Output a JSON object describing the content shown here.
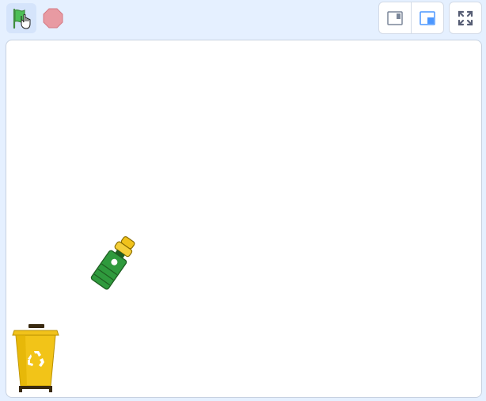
{
  "toolbar": {
    "green_flag_icon": "green-flag-icon",
    "stop_icon": "stop-sign-icon",
    "stage_mode_small_icon": "small-stage-icon",
    "stage_mode_normal_icon": "normal-stage-icon",
    "fullscreen_icon": "fullscreen-icon"
  },
  "stage": {
    "sprites": [
      {
        "name": "bottle",
        "icon": "bottle-sprite"
      },
      {
        "name": "recycle-bin",
        "icon": "recycle-bin-sprite"
      }
    ]
  },
  "colors": {
    "background": "#e5f0ff",
    "flag_green": "#59c059",
    "stop_red": "#ec5959",
    "accent_blue": "#4c97ff",
    "bin_yellow": "#f1c21b"
  }
}
